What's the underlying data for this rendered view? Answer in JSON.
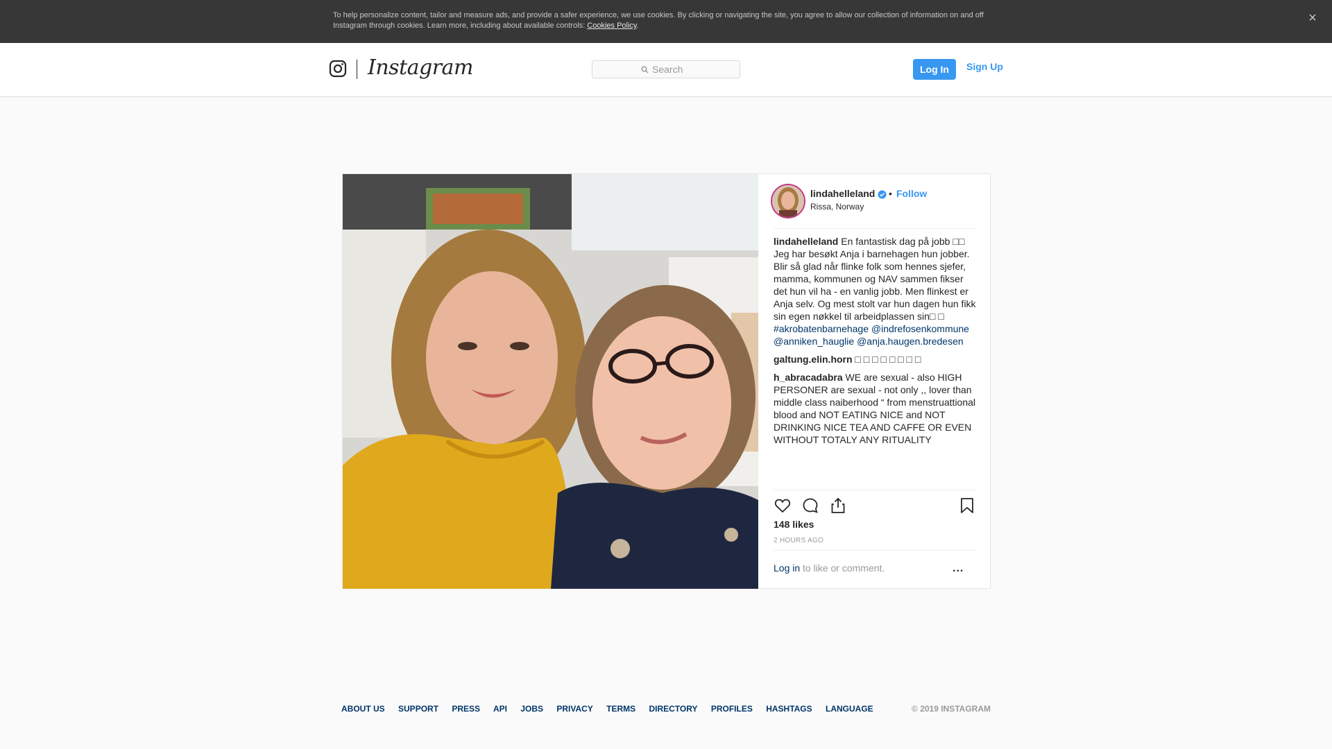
{
  "cookie_banner": {
    "text": "To help personalize content, tailor and measure ads, and provide a safer experience, we use cookies. By clicking or navigating the site, you agree to allow our collection of information on and off Instagram through cookies. Learn more, including about available controls: ",
    "link": "Cookies Policy",
    "link_suffix": ".",
    "close": "×"
  },
  "header": {
    "logo_text": "Instagram",
    "search_placeholder": "Search",
    "login_label": "Log In",
    "signup_label": "Sign Up"
  },
  "post": {
    "username": "lindahelleland",
    "follow_label": "Follow",
    "dot": "•",
    "location": "Rissa, Norway",
    "caption_user": "lindahelleland",
    "caption_text": " En fantastisk dag på jobb □□ Jeg har besøkt Anja i barnehagen hun jobber. Blir så glad når flinke folk som hennes sjefer, mamma, kommunen og NAV sammen fikser det hun vil ha - en vanlig jobb. Men flinkest er Anja selv. Og mest stolt var hun dagen hun fikk sin egen nøkkel til arbeidplassen sin□ □ ",
    "tags": [
      "#akrobatenbarnehage",
      "@indrefosenkommune",
      "@anniken_hauglie",
      "@anja.haugen.bredesen"
    ],
    "comments": [
      {
        "user": "galtung.elin.horn",
        "text": " □ □ □ □ □ □ □ □"
      },
      {
        "user": "h_abracadabra",
        "text": " WE are sexual - also HIGH PERSONER are sexual - not only ,, lover than middle class naiberhood “ from menstruattional blood and NOT EATING NICE and NOT DRINKING NICE TEA AND CAFFE OR EVEN WITHOUT TOTALY ANY RITUALITY"
      }
    ],
    "likes": "148 likes",
    "time": "2 HOURS AGO",
    "login_link": "Log in",
    "login_suffix": " to like or comment.",
    "more": "..."
  },
  "footer": {
    "links": [
      "About us",
      "Support",
      "Press",
      "API",
      "Jobs",
      "Privacy",
      "Terms",
      "Directory",
      "Profiles",
      "Hashtags",
      "Language"
    ],
    "copyright": "© 2019 Instagram"
  },
  "colors": {
    "accent": "#3897f0",
    "link": "#003569",
    "banner": "#373737"
  }
}
